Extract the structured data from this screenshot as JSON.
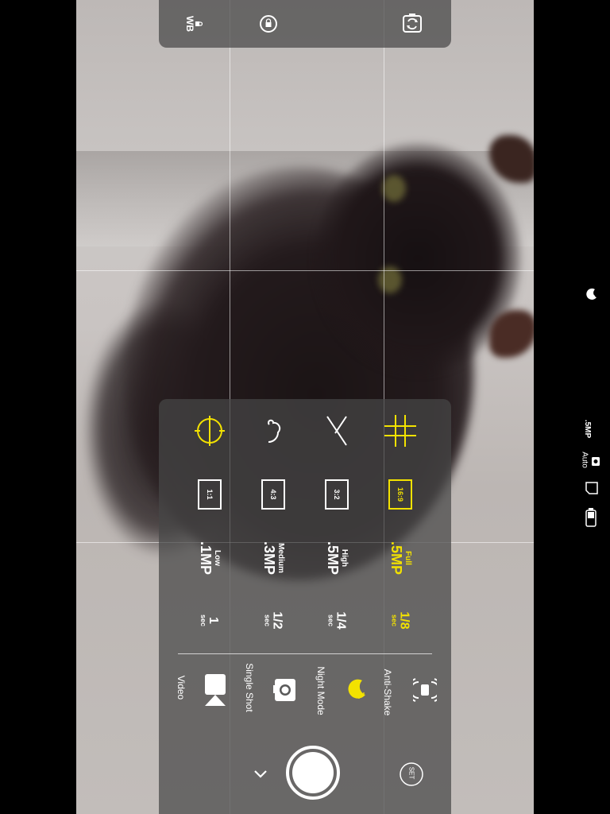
{
  "top_bar": {
    "wb_label": "WB",
    "wb_lock_icon": "lock-icon",
    "exposure_lock_icon": "lock-circle-icon",
    "flip_camera_icon": "flip-camera-icon"
  },
  "composition_guides": [
    {
      "id": "center",
      "icon": "crosshair-icon",
      "active": true
    },
    {
      "id": "golden-spiral",
      "icon": "spiral-icon",
      "active": false
    },
    {
      "id": "diagonal",
      "icon": "diagonal-icon",
      "active": false
    },
    {
      "id": "thirds-grid",
      "icon": "grid-icon",
      "active": true
    }
  ],
  "aspect_ratios": [
    {
      "label": "1:1",
      "active": false
    },
    {
      "label": "4:3",
      "active": false
    },
    {
      "label": "3:2",
      "active": false
    },
    {
      "label": "16:9",
      "active": true
    }
  ],
  "resolutions": [
    {
      "quality": "Low",
      "value": ".1MP",
      "active": false
    },
    {
      "quality": "Medium",
      "value": ".3MP",
      "active": false
    },
    {
      "quality": "High",
      "value": ".5MP",
      "active": false
    },
    {
      "quality": "Full",
      "value": ".5MP",
      "active": true
    }
  ],
  "timers": [
    {
      "value": "1",
      "unit": "sec",
      "active": false
    },
    {
      "value": "1/2",
      "unit": "sec",
      "active": false
    },
    {
      "value": "1/4",
      "unit": "sec",
      "active": false
    },
    {
      "value": "1/8",
      "unit": "sec",
      "active": true
    }
  ],
  "modes": [
    {
      "label": "Video",
      "icon": "video-camera-icon",
      "active": false
    },
    {
      "label": "Single Shot",
      "icon": "camera-icon",
      "active": false
    },
    {
      "label": "Night Mode",
      "icon": "moon-sun-icon",
      "active": true
    },
    {
      "label": "Anti-Shake",
      "icon": "vibration-icon",
      "active": false
    }
  ],
  "controls": {
    "collapse_icon": "chevron-down-icon",
    "shutter_icon": "shutter-button",
    "settings_label": "SET"
  },
  "status": {
    "night_icon": "moon-sun-icon",
    "resolution": ".5MP",
    "camera_mode": "Auto",
    "storage_icon": "sd-card-icon",
    "battery_icon": "battery-icon"
  },
  "colors": {
    "accent": "#f3e200",
    "panel": "#464646"
  }
}
